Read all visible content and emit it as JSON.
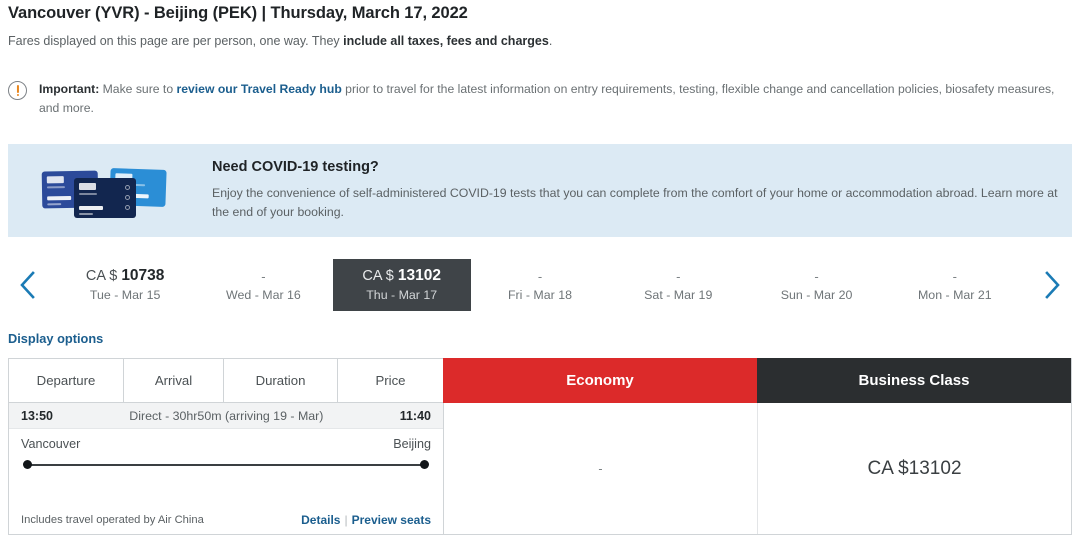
{
  "header": {
    "route_title": "Vancouver (YVR) - Beijing (PEK) | Thursday, March 17, 2022",
    "fares_note_pre": "Fares displayed on this page are per person, one way. They ",
    "fares_note_bold": "include all taxes, fees and charges",
    "fares_note_post": "."
  },
  "important": {
    "icon": "alert-circle-icon",
    "label": "Important:",
    "text_pre": " Make sure to ",
    "link": "review our Travel Ready hub",
    "text_post": " prior to travel for the latest information on entry requirements, testing, flexible change and cancellation policies, biosafety measures, and more."
  },
  "covid_banner": {
    "image_name": "covid-test-kits-image",
    "title": "Need COVID-19 testing?",
    "description": "Enjoy the convenience of self-administered COVID-19 tests that you can complete from the comfort of your home or accommodation abroad. Learn more at the end of your booking."
  },
  "date_carousel": {
    "prev_icon": "chevron-left-icon",
    "next_icon": "chevron-right-icon",
    "accent_color": "#1b7bb5",
    "selected_bg": "#3f4448",
    "dates": [
      {
        "currency": "CA $",
        "price": "10738",
        "has_price": true,
        "day": "Tue - Mar 15",
        "selected": false
      },
      {
        "currency": "",
        "price": "-",
        "has_price": false,
        "day": "Wed - Mar 16",
        "selected": false
      },
      {
        "currency": "CA $",
        "price": "13102",
        "has_price": true,
        "day": "Thu - Mar 17",
        "selected": true
      },
      {
        "currency": "",
        "price": "-",
        "has_price": false,
        "day": "Fri - Mar 18",
        "selected": false
      },
      {
        "currency": "",
        "price": "-",
        "has_price": false,
        "day": "Sat - Mar 19",
        "selected": false
      },
      {
        "currency": "",
        "price": "-",
        "has_price": false,
        "day": "Sun - Mar 20",
        "selected": false
      },
      {
        "currency": "",
        "price": "-",
        "has_price": false,
        "day": "Mon - Mar 21",
        "selected": false
      }
    ]
  },
  "display_options": {
    "label": "Display options"
  },
  "results_table": {
    "columns": {
      "departure": "Departure",
      "arrival": "Arrival",
      "duration": "Duration",
      "price": "Price"
    },
    "cabins": [
      {
        "label": "Economy",
        "color": "#dc2a2a"
      },
      {
        "label": "Business Class",
        "color": "#2b2e30"
      }
    ],
    "rows": [
      {
        "depart_time": "13:50",
        "summary": "Direct - 30hr50m (arriving 19 - Mar)",
        "arrive_time": "11:40",
        "origin_city": "Vancouver",
        "destination_city": "Beijing",
        "operated_by": "Includes travel operated by Air China",
        "details_link": "Details",
        "separator": "|",
        "preview_seats_link": "Preview seats",
        "economy_fare": "-",
        "business_fare": "CA $13102"
      }
    ]
  }
}
